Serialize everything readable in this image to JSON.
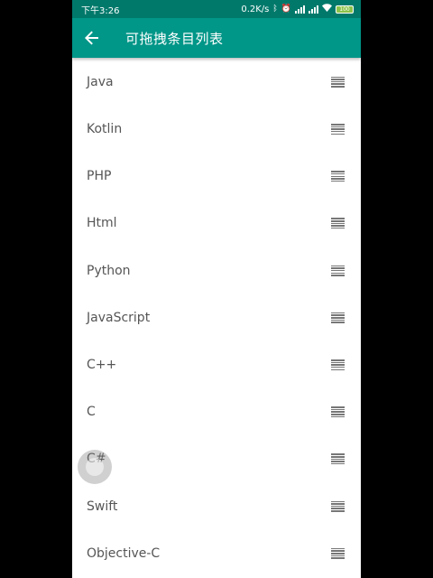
{
  "status_bar": {
    "time": "下午3:26",
    "network_speed": "0.2K/s",
    "icons": [
      "bluetooth-icon",
      "alarm-icon",
      "signal-icon",
      "signal-icon",
      "wifi-icon",
      "battery-icon"
    ],
    "battery_level": "100"
  },
  "toolbar": {
    "back_icon": "arrow-left-icon",
    "title": "可拖拽条目列表",
    "background_color": "#009688",
    "status_color": "#00796b"
  },
  "list": {
    "items": [
      {
        "label": "Java"
      },
      {
        "label": "Kotlin"
      },
      {
        "label": "PHP"
      },
      {
        "label": "Html"
      },
      {
        "label": "Python"
      },
      {
        "label": "JavaScript"
      },
      {
        "label": "C++"
      },
      {
        "label": "C"
      },
      {
        "label": "C#"
      },
      {
        "label": "Swift"
      },
      {
        "label": "Objective-C"
      }
    ],
    "handle_icon": "drag-handle-icon"
  }
}
